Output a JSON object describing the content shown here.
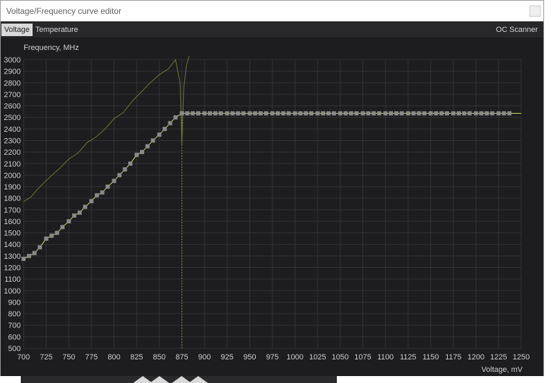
{
  "window": {
    "title": "Voltage/Frequency curve editor"
  },
  "tabs": {
    "voltage": "Voltage",
    "temperature": "Temperature",
    "oc_scanner": "OC Scanner"
  },
  "colors": {
    "background": "#1d1d1f",
    "grid": "#333338",
    "curve_line": "#d6e26a",
    "point": "#8a8a8a",
    "secondary_line": "#6f7a3a",
    "axis_text": "#d0d0d0"
  },
  "chart_data": {
    "type": "line",
    "ylabel": "Frequency, MHz",
    "xlabel": "Voltage, mV",
    "xlim": [
      700,
      1250
    ],
    "ylim": [
      500,
      3000
    ],
    "x_ticks": [
      700,
      725,
      750,
      775,
      800,
      825,
      850,
      875,
      900,
      925,
      950,
      975,
      1000,
      1025,
      1050,
      1075,
      1100,
      1125,
      1150,
      1175,
      1200,
      1225,
      1250
    ],
    "y_ticks": [
      500,
      600,
      700,
      800,
      900,
      1000,
      1100,
      1200,
      1300,
      1400,
      1500,
      1600,
      1700,
      1800,
      1900,
      2000,
      2100,
      2200,
      2300,
      2400,
      2500,
      2600,
      2700,
      2800,
      2900,
      3000
    ],
    "grid": true,
    "series": [
      {
        "kind": "vf-curve",
        "x": [
          700,
          706,
          712,
          718,
          725,
          731,
          737,
          743,
          750,
          756,
          762,
          768,
          775,
          781,
          787,
          793,
          800,
          806,
          812,
          818,
          825,
          831,
          837,
          843,
          850,
          856,
          862,
          868,
          875
        ],
        "y": [
          1275,
          1300,
          1325,
          1375,
          1450,
          1475,
          1500,
          1550,
          1600,
          1650,
          1675,
          1725,
          1775,
          1825,
          1850,
          1900,
          1950,
          2000,
          2050,
          2100,
          2175,
          2200,
          2250,
          2300,
          2350,
          2400,
          2450,
          2500,
          2535
        ]
      },
      {
        "kind": "flat-segment",
        "x": [
          875,
          1250
        ],
        "y": [
          2535,
          2535
        ]
      },
      {
        "kind": "voltage-locked-marker",
        "x": [
          875,
          875
        ],
        "y": [
          500,
          2535
        ]
      },
      {
        "kind": "secondary-curve",
        "x": [
          700,
          708,
          718,
          730,
          740,
          750,
          760,
          770,
          780,
          790,
          800,
          810,
          820,
          830,
          840,
          850,
          860,
          868,
          873,
          875,
          877,
          880,
          883
        ],
        "y": [
          1770,
          1810,
          1900,
          1990,
          2060,
          2140,
          2190,
          2280,
          2330,
          2400,
          2490,
          2540,
          2640,
          2720,
          2800,
          2870,
          2920,
          3000,
          2800,
          2260,
          2750,
          2950,
          3030
        ]
      }
    ],
    "flat_point_voltages": [
      875,
      881,
      887,
      893,
      900,
      906,
      912,
      918,
      925,
      931,
      937,
      943,
      950,
      956,
      962,
      968,
      975,
      981,
      987,
      993,
      1000,
      1006,
      1012,
      1018,
      1025,
      1031,
      1037,
      1043,
      1050,
      1056,
      1062,
      1068,
      1075,
      1081,
      1087,
      1093,
      1100,
      1106,
      1112,
      1118,
      1125,
      1131,
      1137,
      1143,
      1150,
      1156,
      1162,
      1168,
      1175,
      1181,
      1187,
      1193,
      1200,
      1206,
      1212,
      1218,
      1225,
      1231,
      1237
    ]
  }
}
